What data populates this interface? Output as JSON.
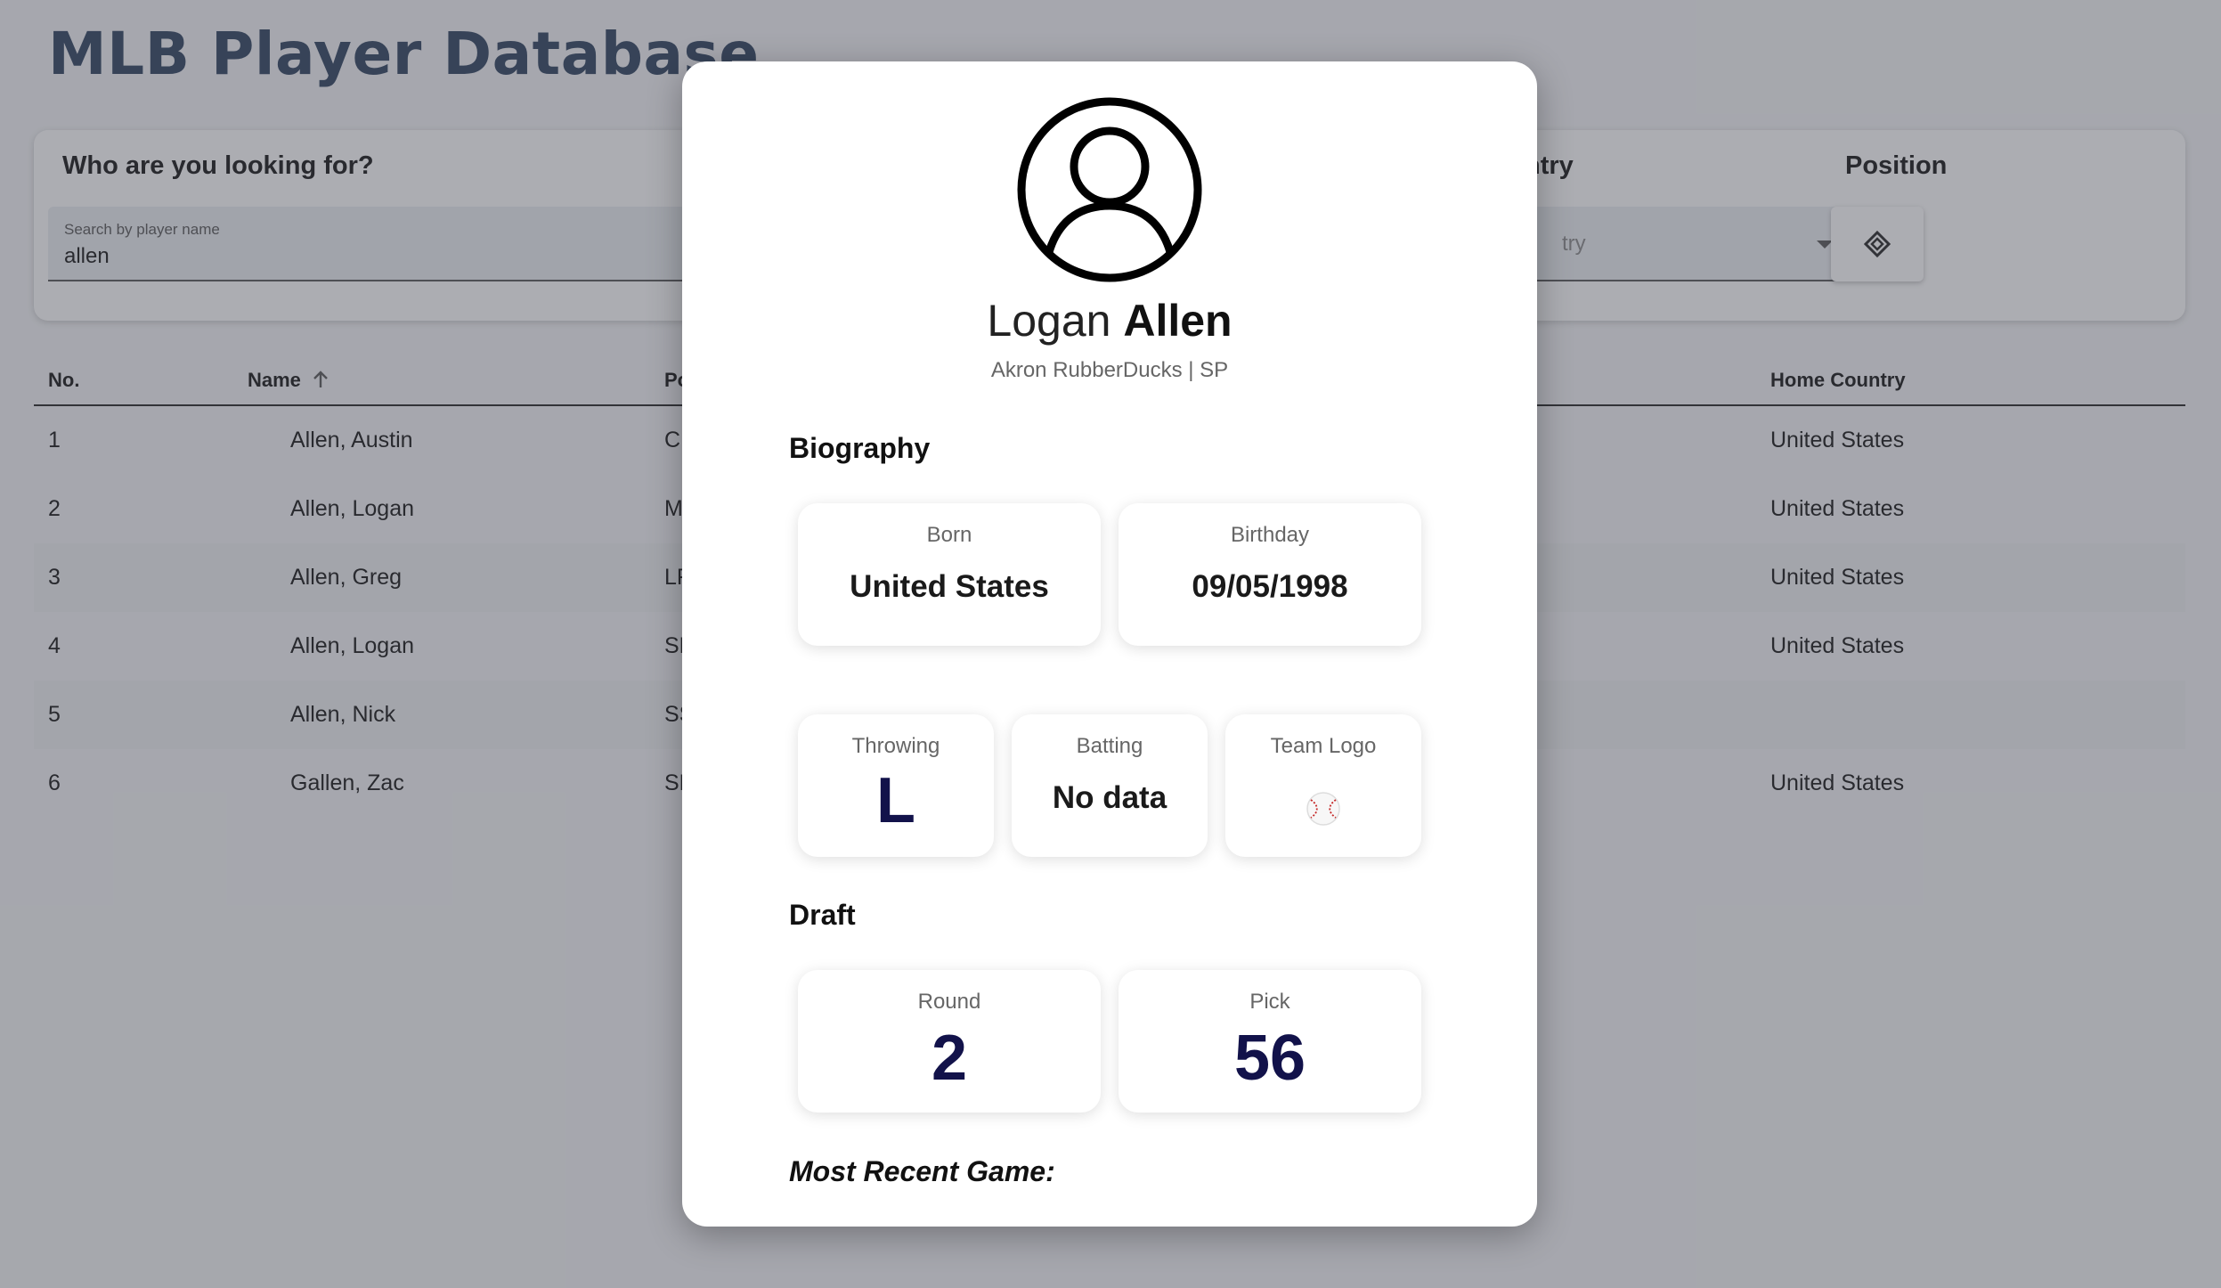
{
  "page": {
    "title": "MLB Player Database"
  },
  "filters": {
    "search_heading": "Who are you looking for?",
    "search_label": "Search by player name",
    "search_value": "allen",
    "country_heading": "ntry",
    "country_placeholder": "try",
    "position_heading": "Position",
    "position_icon": "baseball-diamond-icon"
  },
  "table": {
    "headers": {
      "no": "No.",
      "name": "Name",
      "position": "Po",
      "home_country": "Home Country"
    },
    "sort_icon": "arrow-up-icon",
    "rows": [
      {
        "no": "1",
        "name": "Allen, Austin",
        "position": "C",
        "home_country": "United States"
      },
      {
        "no": "2",
        "name": "Allen, Logan",
        "position": "M",
        "home_country": "United States"
      },
      {
        "no": "3",
        "name": "Allen, Greg",
        "position": "LF",
        "home_country": "United States"
      },
      {
        "no": "4",
        "name": "Allen, Logan",
        "position": "SF",
        "home_country": "United States"
      },
      {
        "no": "5",
        "name": "Allen, Nick",
        "position": "SS",
        "home_country": ""
      },
      {
        "no": "6",
        "name": "Gallen, Zac",
        "position": "SF",
        "home_country": "United States"
      }
    ]
  },
  "modal": {
    "avatar_icon": "user-avatar-icon",
    "first_name": "Logan",
    "last_name": "Allen",
    "subtitle": "Akron RubberDucks | SP",
    "biography_title": "Biography",
    "born": {
      "label": "Born",
      "value": "United States"
    },
    "birthday": {
      "label": "Birthday",
      "value": "09/05/1998"
    },
    "throwing": {
      "label": "Throwing",
      "value": "L"
    },
    "batting": {
      "label": "Batting",
      "value": "No data"
    },
    "team_logo": {
      "label": "Team Logo",
      "icon": "baseball-icon"
    },
    "draft_title": "Draft",
    "round": {
      "label": "Round",
      "value": "2"
    },
    "pick": {
      "label": "Pick",
      "value": "56"
    },
    "recent_game_title": "Most Recent Game:"
  },
  "colors": {
    "title": "#2b3f5c",
    "stat_big": "#12124a",
    "overlay": "rgba(70,74,84,0.45)"
  }
}
